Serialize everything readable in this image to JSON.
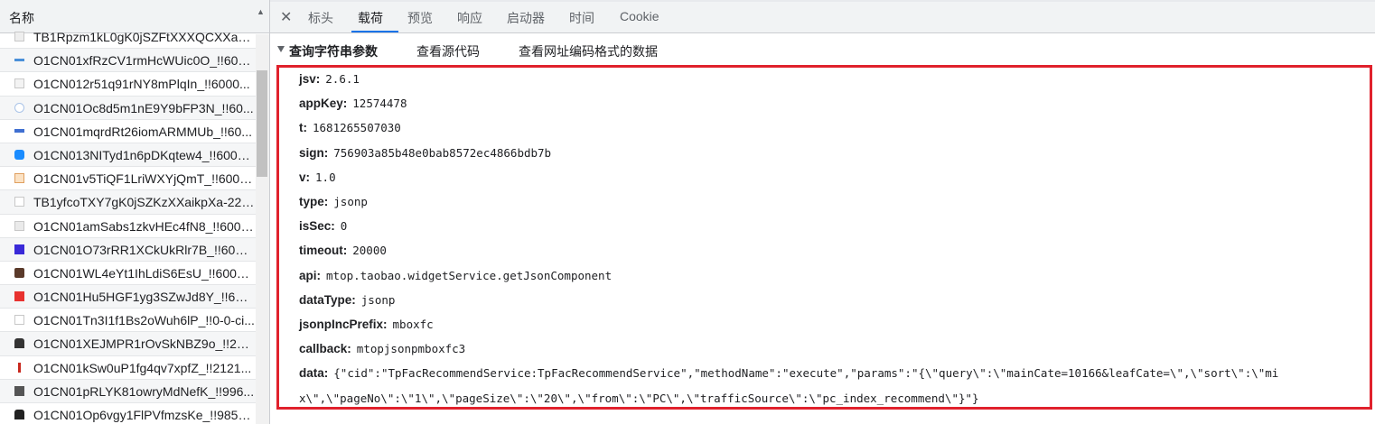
{
  "left_panel": {
    "header": "名称",
    "files": [
      {
        "name": "TB1Rpzm1kL0gK0jSZFtXXXQCXXa-2...",
        "icon": "image-thumb-icon"
      },
      {
        "name": "O1CN01xfRzCV1rmHcWUic0O_!!600...",
        "icon": "image-thumb-icon"
      },
      {
        "name": "O1CN012r51q91rNY8mPlqIn_!!6000...",
        "icon": "image-thumb-icon"
      },
      {
        "name": "O1CN01Oc8d5m1nE9Y9bFP3N_!!60...",
        "icon": "image-thumb-icon"
      },
      {
        "name": "O1CN01mqrdRt26iomARMMUb_!!60...",
        "icon": "image-thumb-icon"
      },
      {
        "name": "O1CN013NITyd1n6pDKqtew4_!!6000...",
        "icon": "image-thumb-icon"
      },
      {
        "name": "O1CN01v5TiQF1LriWXYjQmT_!!6000...",
        "icon": "image-thumb-icon"
      },
      {
        "name": "TB1yfcoTXY7gK0jSZKzXXaikpXa-22-...",
        "icon": "image-thumb-icon"
      },
      {
        "name": "O1CN01amSabs1zkvHEc4fN8_!!6000...",
        "icon": "image-thumb-icon"
      },
      {
        "name": "O1CN01O73rRR1XCkUkRlr7B_!!6000...",
        "icon": "image-thumb-icon"
      },
      {
        "name": "O1CN01WL4eYt1IhLdiS6EsU_!!60000...",
        "icon": "image-thumb-icon"
      },
      {
        "name": "O1CN01Hu5HGF1yg3SZwJd8Y_!!600...",
        "icon": "image-thumb-icon"
      },
      {
        "name": "O1CN01Tn3I1f1Bs2oWuh6lP_!!0-0-ci...",
        "icon": "image-thumb-icon"
      },
      {
        "name": "O1CN01XEJMPR1rOvSkNBZ9o_!!221...",
        "icon": "image-thumb-icon"
      },
      {
        "name": "O1CN01kSw0uP1fg4qv7xpfZ_!!2121...",
        "icon": "image-thumb-icon"
      },
      {
        "name": "O1CN01pRLYK81owryMdNefK_!!996...",
        "icon": "image-thumb-icon"
      },
      {
        "name": "O1CN01Op6vgy1FlPVfmzsKe_!!9856...",
        "icon": "image-thumb-icon"
      }
    ]
  },
  "tabs": {
    "close_label": "✕",
    "items": [
      "标头",
      "载荷",
      "预览",
      "响应",
      "启动器",
      "时间",
      "Cookie"
    ],
    "active": "载荷"
  },
  "section": {
    "title": "查询字符串参数",
    "view_source": "查看源代码",
    "view_encoded": "查看网址编码格式的数据"
  },
  "params": [
    {
      "key": "jsv:",
      "value": "2.6.1"
    },
    {
      "key": "appKey:",
      "value": "12574478"
    },
    {
      "key": "t:",
      "value": "1681265507030"
    },
    {
      "key": "sign:",
      "value": "756903a85b48e0bab8572ec4866bdb7b"
    },
    {
      "key": "v:",
      "value": "1.0"
    },
    {
      "key": "type:",
      "value": "jsonp"
    },
    {
      "key": "isSec:",
      "value": "0"
    },
    {
      "key": "timeout:",
      "value": "20000"
    },
    {
      "key": "api:",
      "value": "mtop.taobao.widgetService.getJsonComponent"
    },
    {
      "key": "dataType:",
      "value": "jsonp"
    },
    {
      "key": "jsonpIncPrefix:",
      "value": "mboxfc"
    },
    {
      "key": "callback:",
      "value": "mtopjsonpmboxfc3"
    },
    {
      "key": "data:",
      "value": "{\"cid\":\"TpFacRecommendService:TpFacRecommendService\",\"methodName\":\"execute\",\"params\":\"{\\\"query\\\":\\\"mainCate=10166&leafCate=\\\",\\\"sort\\\":\\\"mi"
    },
    {
      "key": "",
      "value": "x\\\",\\\"pageNo\\\":\\\"1\\\",\\\"pageSize\\\":\\\"20\\\",\\\"from\\\":\\\"PC\\\",\\\"trafficSource\\\":\\\"pc_index_recommend\\\"}\"}"
    }
  ],
  "colors": {
    "highlight_border": "#e0212c",
    "active_tab_underline": "#1a73e8"
  }
}
